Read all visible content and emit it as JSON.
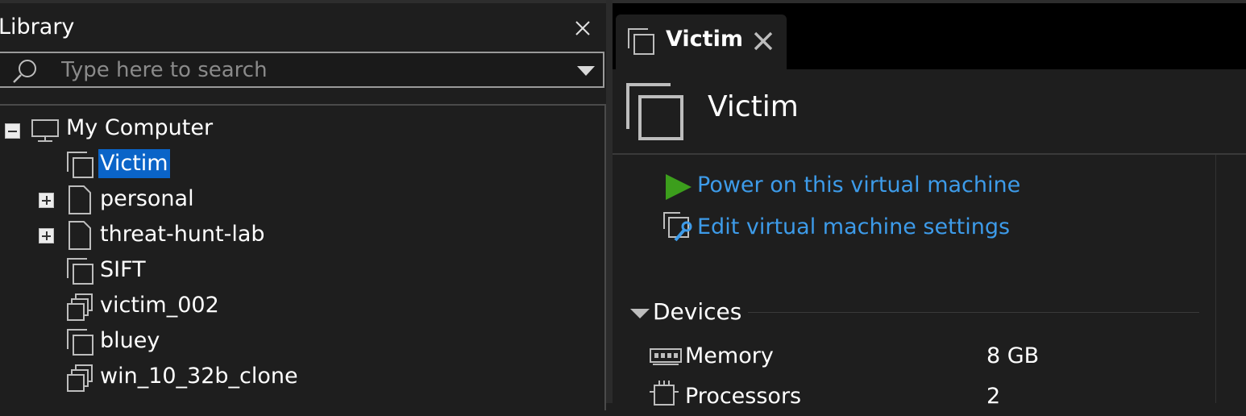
{
  "library": {
    "title": "Library",
    "search": {
      "placeholder": "Type here to search",
      "value": ""
    },
    "tree": {
      "root_label": "My Computer",
      "items": [
        {
          "label": "Victim",
          "icon": "vm-icon",
          "selected": true,
          "expandable": false
        },
        {
          "label": "personal",
          "icon": "folder-icon",
          "selected": false,
          "expandable": true
        },
        {
          "label": "threat-hunt-lab",
          "icon": "folder-icon",
          "selected": false,
          "expandable": true
        },
        {
          "label": "SIFT",
          "icon": "vm-icon",
          "selected": false,
          "expandable": false
        },
        {
          "label": "victim_002",
          "icon": "linked-clone-vm-icon",
          "selected": false,
          "expandable": false
        },
        {
          "label": "bluey",
          "icon": "vm-icon",
          "selected": false,
          "expandable": false
        },
        {
          "label": "win_10_32b_clone",
          "icon": "linked-clone-vm-icon",
          "selected": false,
          "expandable": false
        }
      ]
    }
  },
  "tabs": [
    {
      "label": "Victim",
      "active": true
    }
  ],
  "vm": {
    "title": "Victim",
    "actions": [
      {
        "label": "Power on this virtual machine",
        "icon": "play-icon"
      },
      {
        "label": "Edit virtual machine settings",
        "icon": "settings-wrench-icon"
      }
    ],
    "devices_heading": "Devices",
    "devices": [
      {
        "name": "Memory",
        "value": "8 GB",
        "icon": "memory-icon"
      },
      {
        "name": "Processors",
        "value": "2",
        "icon": "processor-icon"
      }
    ]
  },
  "colors": {
    "background": "#1e1e1e",
    "tab_bar": "#000000",
    "selection": "#0a64c8",
    "link": "#3d9be9",
    "play": "#3c9e1c"
  }
}
